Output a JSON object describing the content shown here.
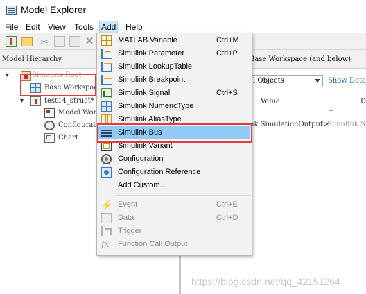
{
  "window": {
    "title": "Model Explorer",
    "icon": "model-explorer-icon"
  },
  "menubar": [
    "File",
    "Edit",
    "View",
    "Tools",
    "Add",
    "Help"
  ],
  "toolbar": {
    "icons": [
      "add-model-icon",
      "open-folder-icon",
      "cut-icon",
      "copy-icon",
      "paste-icon",
      "delete-icon"
    ]
  },
  "hierarchy": {
    "header": "Model Hierarchy",
    "nodes": [
      {
        "label": "Simulink Root",
        "icon": "simulink-root-icon"
      },
      {
        "label": "Base Workspace",
        "icon": "workspace-icon"
      },
      {
        "label": "test14_struct*",
        "icon": "model-icon"
      },
      {
        "label": "Model Works",
        "icon": "model-workspace-icon"
      },
      {
        "label": "Configuratio",
        "icon": "configuration-icon"
      },
      {
        "label": "Chart",
        "icon": "chart-icon"
      }
    ]
  },
  "contents": {
    "header": "Base Workspace (and below)",
    "filter": "l Objects",
    "show_details": "Show Detail",
    "columns": [
      "Value",
      "Da"
    ],
    "row": {
      "value": "nk.SimulationOutput>",
      "data": "Simulink.S"
    }
  },
  "add_menu": {
    "items": [
      {
        "label": "MATLAB Variable",
        "shortcut": "Ctrl+M",
        "icon": "matlab-variable-icon",
        "enabled": true
      },
      {
        "label": "Simulink Parameter",
        "shortcut": "Ctrl+P",
        "icon": "simulink-parameter-icon",
        "enabled": true
      },
      {
        "label": "Simulink LookupTable",
        "shortcut": "",
        "icon": "lookup-table-icon",
        "enabled": true
      },
      {
        "label": "Simulink Breakpoint",
        "shortcut": "",
        "icon": "breakpoint-icon",
        "enabled": true
      },
      {
        "label": "Simulink Signal",
        "shortcut": "Ctrl+S",
        "icon": "signal-icon",
        "enabled": true
      },
      {
        "label": "Simulink NumericType",
        "shortcut": "",
        "icon": "numeric-type-icon",
        "enabled": true
      },
      {
        "label": "Simulink AliasType",
        "shortcut": "",
        "icon": "alias-type-icon",
        "enabled": true
      },
      {
        "label": "Simulink Bus",
        "shortcut": "",
        "icon": "bus-icon",
        "enabled": true,
        "selected": true
      },
      {
        "label": "Simulink Variant",
        "shortcut": "",
        "icon": "variant-icon",
        "enabled": true
      },
      {
        "label": "Configuration",
        "shortcut": "",
        "icon": "configuration-icon",
        "enabled": true
      },
      {
        "label": "Configuration Reference",
        "shortcut": "",
        "icon": "configuration-reference-icon",
        "enabled": true
      },
      {
        "label": "Add Custom...",
        "shortcut": "",
        "icon": "",
        "enabled": true
      },
      {
        "label": "Event",
        "shortcut": "Ctrl+E",
        "icon": "event-icon",
        "enabled": false
      },
      {
        "label": "Data",
        "shortcut": "Ctrl+D",
        "icon": "data-icon",
        "enabled": false
      },
      {
        "label": "Trigger",
        "shortcut": "",
        "icon": "trigger-icon",
        "enabled": false
      },
      {
        "label": "Function Call Output",
        "shortcut": "",
        "icon": "function-call-icon",
        "enabled": false
      }
    ]
  },
  "watermark": "https://blog.csdn.net/qq_42151264",
  "colors": {
    "highlight_box": "#e23b3b",
    "menu_selected": "#91c9f7",
    "link": "#1a5fb4"
  }
}
